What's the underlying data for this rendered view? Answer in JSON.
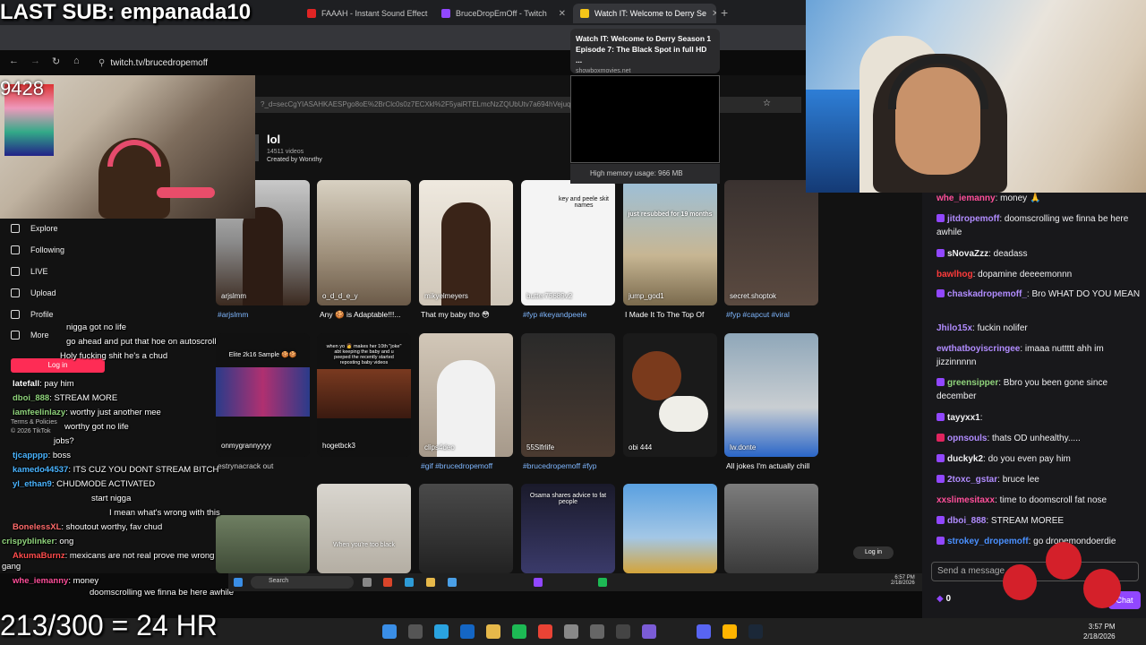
{
  "overlay": {
    "top_text": "LAST SUB: empanada10",
    "bottom_text": "213/300 = 24 HR",
    "counter": "9428"
  },
  "browser": {
    "tabs": [
      {
        "label": "FAAAH - Instant Sound Effect B"
      },
      {
        "label": "BruceDropEmOff - Twitch"
      },
      {
        "label": "Watch IT: Welcome to Derry Se"
      }
    ],
    "url": "twitch.tv/brucedropemoff"
  },
  "tooltip": {
    "title": "Watch IT: Welcome to Derry Season 1 Episode 7: The Black Spot in full HD ...",
    "site": "showboxmovies.net",
    "memory": "High memory usage: 966 MB"
  },
  "tiktok": {
    "url": "?_d=secCgYIASAHKAESPgo8oE%2BrClc0s0z7ECXkl%2F5yaiRTELmcNzZQUbUtv7a694hVejuqUPLALXh8Nu",
    "title": "lol",
    "videos_count": "14511 videos",
    "created_by": "Created by Worxthy",
    "nav": [
      "Explore",
      "Following",
      "LIVE",
      "Upload",
      "Profile",
      "More"
    ],
    "login": "Log in",
    "login2": "Log in",
    "footer": [
      "Terms & Policies",
      "© 2026 TikTok"
    ],
    "row1": [
      {
        "user": "arjslmm",
        "caption": "#arjslmm",
        "hash": true
      },
      {
        "user": "o_d_d_e_y",
        "caption": "Any 🍪 is Adaptable!!!...",
        "hash": false
      },
      {
        "user": "mikyelmeyers",
        "caption": "That my baby tho 😳",
        "hash": false
      },
      {
        "user": "butter75689v2",
        "caption": "#fyp #keyandpeele",
        "hash": true
      },
      {
        "user": "jump_god1",
        "caption": "I Made It To The Top Of",
        "hash": false
      },
      {
        "user": "secret.shoptok",
        "caption": "#fyp #capcut #viral",
        "hash": true
      }
    ],
    "row2": [
      {
        "user": "onmygrannyyyy",
        "caption": "",
        "hash": false
      },
      {
        "user": "hogetbck3",
        "caption": "",
        "hash": false
      },
      {
        "user": "clips4deo",
        "caption": "#gif #brucedropemoff",
        "hash": true
      },
      {
        "user": "55Slfrlife",
        "caption": "#brucedropemoff #fyp",
        "hash": true
      },
      {
        "user": "obi 444",
        "caption": "",
        "hash": false
      },
      {
        "user": "lw.donte",
        "caption": "All jokes I'm actually chill",
        "hash": false
      }
    ],
    "overlay_texts": {
      "v2a": "Elite 2k16 Sample 🍪🍪",
      "v2b": "when yo 👩 makes her 10th \"joke\" abt keeping the baby and u peeped the recently started reposting baby videos",
      "v1e": "just resubbed for 19 months",
      "v1d": "key and peele skit names",
      "v3d": "Osama shares advice to fat people",
      "v3b": "When you're too black",
      "crack": "estrynacrack out"
    }
  },
  "left_chat": [
    {
      "user": "",
      "msg": "nigga got no life",
      "color": "#ffffff"
    },
    {
      "user": "",
      "msg": "go ahead and put that hoe on autoscroll",
      "color": "#ffffff"
    },
    {
      "user": "",
      "msg": "Holy fucking shit he's a chud",
      "color": "#ffffff"
    },
    {
      "user": "latefall",
      "msg": ": pay him",
      "color": "#ffffff"
    },
    {
      "user": "dboi_888",
      "msg": ": STREAM MORE",
      "color": "#8fd37b"
    },
    {
      "user": "iamfeelinlazy",
      "msg": ": worthy just another mee",
      "color": "#8fd37b"
    },
    {
      "user": "",
      "msg": "worthy got no life",
      "color": "#ffffff"
    },
    {
      "user": "",
      "msg": "jobs?",
      "color": "#ffffff"
    },
    {
      "user": "tjcapppp",
      "msg": ": boss",
      "color": "#4ab4ff"
    },
    {
      "user": "kamedo44537",
      "msg": ": ITS CUZ YOU DONT STREAM BITCH",
      "color": "#4ab4ff"
    },
    {
      "user": "yl_ethan9",
      "msg": ": CHUDMODE ACTIVATED",
      "color": "#4ab4ff"
    },
    {
      "user": "",
      "msg": "start nigga",
      "color": "#ffffff"
    },
    {
      "user": "",
      "msg": "I mean what's wrong with this",
      "color": "#ffffff"
    },
    {
      "user": "BonelessXL",
      "msg": ": shoutout worthy, fav chud",
      "color": "#ff6b6b"
    },
    {
      "user": "crispyblinker",
      "msg": ": ong",
      "color": "#8fd37b"
    },
    {
      "user": "AkumaBurnz",
      "msg": ": mexicans are not real prove me wrong",
      "color": "#ff4d4d"
    },
    {
      "user": "",
      "msg": "gang",
      "color": "#ffffff"
    },
    {
      "user": "whe_iemanny",
      "msg": ": money",
      "color": "#ffffff"
    },
    {
      "user": "",
      "msg": "doomscrolling we finna be here awhile",
      "color": "#ffffff"
    }
  ],
  "right_chat": [
    {
      "user": "whe_iemanny",
      "msg": ": money 🙏",
      "color": "#ff4f9a"
    },
    {
      "user": "jitdropemoff",
      "msg": ": doomscrolling we finna be here awhile",
      "color": "#b18cff"
    },
    {
      "user": "sNovaZzz",
      "msg": ": deadass",
      "color": "#ffffff"
    },
    {
      "user": "bawlhog",
      "msg": ": dopamine deeeemonnn",
      "color": "#ff3b3b"
    },
    {
      "user": "chaskadropemoff_",
      "msg": ": Bro WHAT DO YOU MEAN",
      "color": "#b18cff"
    },
    {
      "user": "Jhilo15x",
      "msg": ": fuckin nolifer",
      "color": "#b18cff"
    },
    {
      "user": "ewthatboyiscringee",
      "msg": ": imaaa nuttttt ahh im jizzinnnnn",
      "color": "#b18cff"
    },
    {
      "user": "greensipper",
      "msg": ": Bbro you been gone since december",
      "color": "#8fd37b"
    },
    {
      "user": "tayyxx1",
      "msg": ":",
      "color": "#ffffff"
    },
    {
      "user": "opnsouls",
      "msg": ": thats OD unhealthy.....",
      "color": "#b18cff"
    },
    {
      "user": "duckyk2",
      "msg": ": do you even pay him",
      "color": "#ffffff"
    },
    {
      "user": "2toxc_gstar",
      "msg": ": bruce lee",
      "color": "#b18cff"
    },
    {
      "user": "xxslimesitaxx",
      "msg": ": time to doomscroll fat nose",
      "color": "#ff4f9a"
    },
    {
      "user": "dboi_888",
      "msg": ": STREAM MOREE",
      "color": "#b18cff"
    },
    {
      "user": "strokey_dropemoff",
      "msg": ": go dropemondoerdie",
      "color": "#4a90ff"
    }
  ],
  "chat_input": {
    "placeholder": "Send a message",
    "points": "0",
    "button": "Chat"
  },
  "inner_taskbar": {
    "search": "Search",
    "time": "6:57 PM",
    "date": "2/18/2026"
  },
  "taskbar": {
    "time": "3:57 PM",
    "date": "2/18/2026"
  }
}
